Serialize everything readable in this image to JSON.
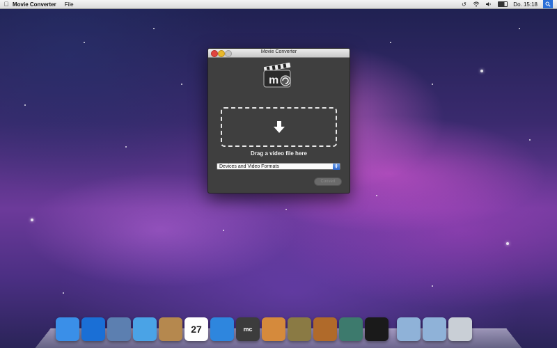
{
  "menubar": {
    "app_name": "Movie Converter",
    "menus": [
      "File"
    ],
    "clock": "Do. 15:18",
    "status_icons": [
      "time-machine-icon",
      "wifi-icon",
      "volume-icon",
      "battery-icon",
      "spotlight-icon"
    ]
  },
  "window": {
    "title": "Movie Converter",
    "logo_text": "mc",
    "drop_label": "Drag a video file here",
    "format_select_value": "Devices and Video Formats",
    "convert_label": "Convert"
  },
  "dock": {
    "items": [
      {
        "name": "finder-icon",
        "color": "#3a8fe8"
      },
      {
        "name": "app-store-icon",
        "color": "#1a6fd6"
      },
      {
        "name": "mail-icon",
        "color": "#5c7fb0"
      },
      {
        "name": "safari-icon",
        "color": "#4aa3e6"
      },
      {
        "name": "address-book-icon",
        "color": "#b5884e"
      },
      {
        "name": "calendar-icon",
        "color": "#ffffff",
        "text": "27"
      },
      {
        "name": "itunes-icon",
        "color": "#2e86de"
      },
      {
        "name": "movie-converter-icon",
        "color": "#3c3c3c",
        "text": "mc"
      },
      {
        "name": "iphoto-icon",
        "color": "#d58a3c"
      },
      {
        "name": "imovie-icon",
        "color": "#8a7a44"
      },
      {
        "name": "garageband-icon",
        "color": "#b06a2a"
      },
      {
        "name": "time-machine-icon",
        "color": "#3d7a6d"
      },
      {
        "name": "terminal-icon",
        "color": "#1a1a1a"
      },
      {
        "name": "applications-folder-icon",
        "color": "#8fb2d8"
      },
      {
        "name": "downloads-folder-icon",
        "color": "#8fb2d8"
      },
      {
        "name": "trash-icon",
        "color": "#c9cfd6"
      }
    ]
  }
}
